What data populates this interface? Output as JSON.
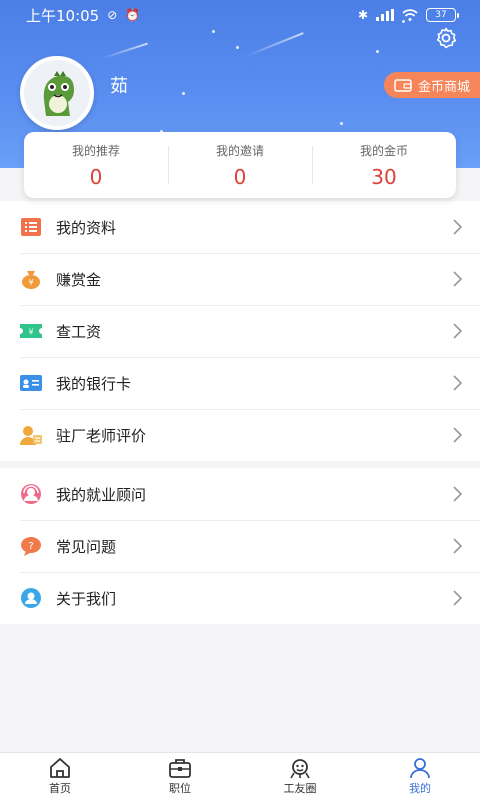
{
  "status_bar": {
    "time": "上午10:05",
    "battery": "37"
  },
  "profile": {
    "username": "茹",
    "coin_mall_label": "金币商城"
  },
  "stats": [
    {
      "label": "我的推荐",
      "value": "0"
    },
    {
      "label": "我的邀请",
      "value": "0"
    },
    {
      "label": "我的金币",
      "value": "30"
    }
  ],
  "menu_group_1": [
    {
      "label": "我的资料",
      "icon": "profile-list-icon",
      "color": "#f0724a"
    },
    {
      "label": "赚赏金",
      "icon": "money-bag-icon",
      "color": "#f09a3a"
    },
    {
      "label": "查工资",
      "icon": "salary-ticket-icon",
      "color": "#2fc48a"
    },
    {
      "label": "我的银行卡",
      "icon": "bank-card-icon",
      "color": "#3a8fe8"
    },
    {
      "label": "驻厂老师评价",
      "icon": "teacher-rating-icon",
      "color": "#f0a83a"
    }
  ],
  "menu_group_2": [
    {
      "label": "我的就业顾问",
      "icon": "advisor-icon",
      "color": "#f06a8a"
    },
    {
      "label": "常见问题",
      "icon": "faq-icon",
      "color": "#f07a4a"
    },
    {
      "label": "关于我们",
      "icon": "about-icon",
      "color": "#3aa8e8"
    }
  ],
  "tabs": [
    {
      "label": "首页",
      "icon": "home-icon"
    },
    {
      "label": "职位",
      "icon": "briefcase-icon"
    },
    {
      "label": "工友圈",
      "icon": "community-icon"
    },
    {
      "label": "我的",
      "icon": "user-icon"
    }
  ],
  "active_tab": "我的",
  "colors": {
    "header": "#4c7fe6",
    "accent": "#3b6fd8",
    "stat_value": "#e0403a",
    "coin_mall": "#f7855a"
  }
}
